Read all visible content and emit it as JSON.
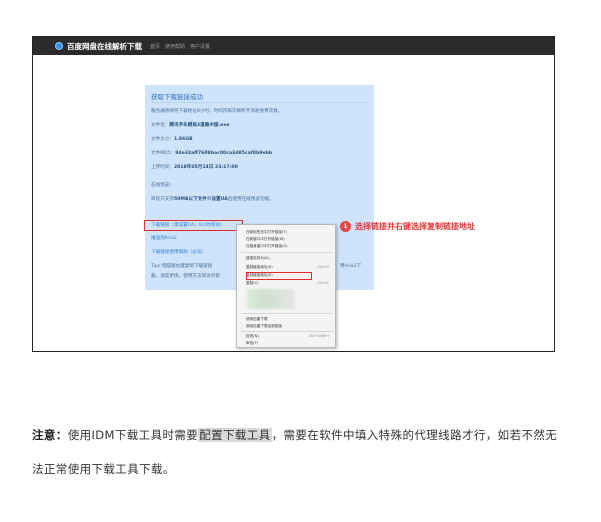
{
  "navbar": {
    "brand": "百度网盘在线解析下载",
    "links": [
      "首页",
      "使用帮助",
      "用户设置"
    ]
  },
  "panel": {
    "title": "获取下载链接成功",
    "notice": "服务器将保存下载地址8小时，时间内再次解析不消耗免费次数。",
    "file_name_label": "文件名：",
    "file_name": "腾讯手车模拟2道路中国.exe",
    "file_size_label": "文件大小：",
    "file_size": "1.86GB",
    "md5_label": "文件MD5：",
    "md5": "94e32aff7608bac00ca3d85caf8b9ebb",
    "upload_time_label": "上传时间：",
    "upload_time": "2018年05月14日 23:17:00",
    "preview_label": "在线预览：",
    "preview_text_pre": "目前只支持",
    "preview_text_bold": "50MB以下文件",
    "preview_text_mid": "和",
    "preview_text_bold2": "设置UA",
    "preview_text_post": "后使用在线预览功能。",
    "download_link": "下载链接（需设置UA，8小时有效）",
    "aria_link": "推送到Aria2",
    "tool_link": "下载链接使用帮助（必读）",
    "tips_line1": "Tips:电脑版右键复制下载链接",
    "tips_line1_end": "用Aria2下",
    "tips_line2": "载，速度更快，使用方法请访问帮"
  },
  "context_menu": {
    "items": [
      {
        "label": "在新标签页中打开链接(T)"
      },
      {
        "label": "在新窗口中打开链接(W)"
      },
      {
        "label": "在隐身窗口中打开链接(G)"
      },
      {
        "label": "链接另存为(K)..."
      },
      {
        "label": "复制链接地址(E)",
        "shortcut": "Ctrl+S"
      },
      {
        "label": "复制链接地址(E)"
      },
      {
        "label": "复制(C)",
        "shortcut": "Ctrl+C"
      },
      {
        "label": "使用迅雷下载"
      },
      {
        "label": "使用迅雷下载全部链接"
      },
      {
        "label": "检查(N)",
        "shortcut": "Ctrl+Shift+I"
      },
      {
        "label": "审查(F)"
      }
    ]
  },
  "annotation": {
    "number": "1",
    "text": "选择链接并右键选择复制链接地址"
  },
  "note": {
    "label": "注意：",
    "text_pre": "使用IDM下载工具时需要",
    "highlight": "配置下载工具",
    "text_post": "，需要在软件中填入特殊的代理线路才行，如若不然无法正常使用下载工具下载。"
  }
}
